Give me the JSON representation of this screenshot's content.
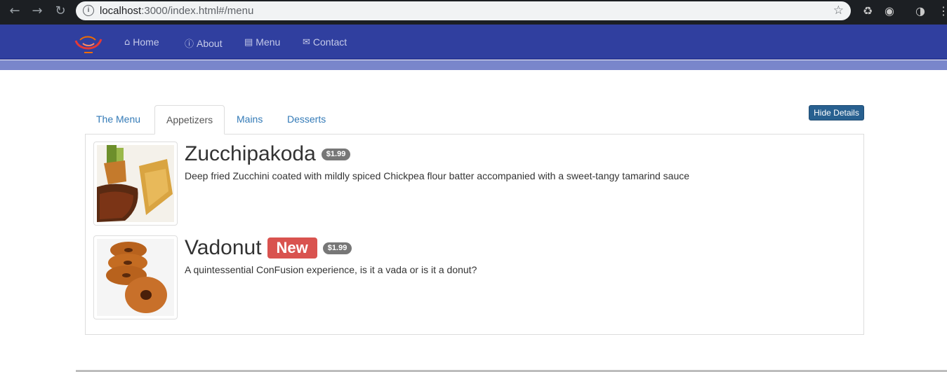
{
  "browser": {
    "url_host": "localhost",
    "url_path": ":3000/index.html#/menu",
    "back_icon": "arrow-left-icon",
    "forward_icon": "arrow-right-icon",
    "reload_icon": "reload-icon",
    "info_icon": "info-icon",
    "star_icon": "star-icon"
  },
  "navbar": {
    "brand_color": "#303f9f",
    "items": [
      {
        "label": "Home",
        "icon": "home-icon"
      },
      {
        "label": "About",
        "icon": "info-circle-icon"
      },
      {
        "label": "Menu",
        "icon": "list-icon"
      },
      {
        "label": "Contact",
        "icon": "envelope-icon"
      }
    ]
  },
  "tabs": {
    "items": [
      {
        "label": "The Menu"
      },
      {
        "label": "Appetizers"
      },
      {
        "label": "Mains"
      },
      {
        "label": "Desserts"
      }
    ],
    "active": "Appetizers"
  },
  "toolbar": {
    "hide_details_label": "Hide Details"
  },
  "dishes": [
    {
      "name": "Zucchipakoda",
      "label": "",
      "price": "$1.99",
      "description": "Deep fried Zucchini coated with mildly spiced Chickpea flour batter accompanied with a sweet-tangy tamarind sauce"
    },
    {
      "name": "Vadonut",
      "label": "New",
      "price": "$1.99",
      "description": "A quintessential ConFusion experience, is it a vada or is it a donut?"
    }
  ]
}
